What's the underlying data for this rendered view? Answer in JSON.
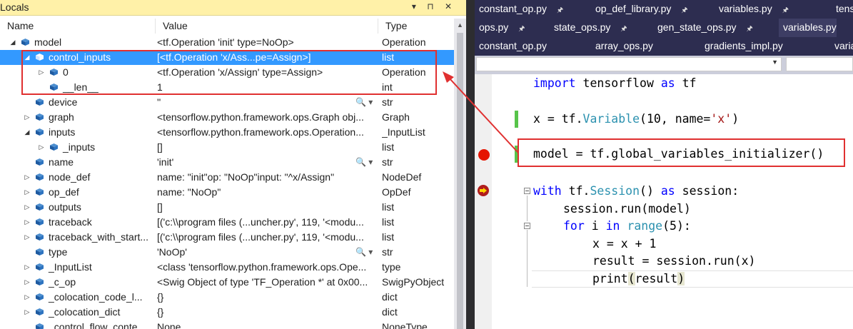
{
  "locals": {
    "title": "Locals",
    "controls": "▾ ⊓ ✕",
    "columns": {
      "name": "Name",
      "value": "Value",
      "type": "Type"
    },
    "rows": [
      {
        "name": "model",
        "value": "<tf.Operation 'init' type=NoOp>",
        "type": "Operation",
        "level": 0,
        "exp": "open"
      },
      {
        "name": "control_inputs",
        "value": "[<tf.Operation 'x/Ass...pe=Assign>]",
        "type": "list",
        "level": 1,
        "exp": "open",
        "selected": true
      },
      {
        "name": "0",
        "value": "<tf.Operation 'x/Assign' type=Assign>",
        "type": "Operation",
        "level": 2,
        "exp": "closed"
      },
      {
        "name": "__len__",
        "value": "1",
        "type": "int",
        "level": 2,
        "exp": "none"
      },
      {
        "name": "device",
        "value": "''",
        "type": "str",
        "level": 1,
        "exp": "none",
        "tools": true
      },
      {
        "name": "graph",
        "value": "<tensorflow.python.framework.ops.Graph obj...",
        "type": "Graph",
        "level": 1,
        "exp": "closed"
      },
      {
        "name": "inputs",
        "value": "<tensorflow.python.framework.ops.Operation...",
        "type": "_InputList",
        "level": 1,
        "exp": "open"
      },
      {
        "name": "_inputs",
        "value": "[]",
        "type": "list",
        "level": 2,
        "exp": "closed"
      },
      {
        "name": "name",
        "value": "'init'",
        "type": "str",
        "level": 1,
        "exp": "none",
        "tools": true
      },
      {
        "name": "node_def",
        "value": "name: \"init\"op: \"NoOp\"input: \"^x/Assign\"",
        "type": "NodeDef",
        "level": 1,
        "exp": "closed"
      },
      {
        "name": "op_def",
        "value": "name: \"NoOp\"",
        "type": "OpDef",
        "level": 1,
        "exp": "closed"
      },
      {
        "name": "outputs",
        "value": "[]",
        "type": "list",
        "level": 1,
        "exp": "closed"
      },
      {
        "name": "traceback",
        "value": "[('c:\\\\program files (...uncher.py', 119, '<modu...",
        "type": "list",
        "level": 1,
        "exp": "closed"
      },
      {
        "name": "traceback_with_start...",
        "value": "[('c:\\\\program files (...uncher.py', 119, '<modu...",
        "type": "list",
        "level": 1,
        "exp": "closed"
      },
      {
        "name": "type",
        "value": "'NoOp'",
        "type": "str",
        "level": 1,
        "exp": "none",
        "tools": true
      },
      {
        "name": "_InputList",
        "value": "<class 'tensorflow.python.framework.ops.Ope...",
        "type": "type",
        "level": 1,
        "exp": "closed"
      },
      {
        "name": "_c_op",
        "value": "<Swig Object of type 'TF_Operation *' at 0x00...",
        "type": "SwigPyObject",
        "level": 1,
        "exp": "closed"
      },
      {
        "name": "_colocation_code_l...",
        "value": "{}",
        "type": "dict",
        "level": 1,
        "exp": "closed"
      },
      {
        "name": "_colocation_dict",
        "value": "{}",
        "type": "dict",
        "level": 1,
        "exp": "closed"
      },
      {
        "name": "_control_flow_conte...",
        "value": "None",
        "type": "NoneType",
        "level": 1,
        "exp": "none"
      }
    ]
  },
  "editor": {
    "tabs_row1": [
      "constant_op.py",
      "op_def_library.py",
      "variables.py",
      "tensor..."
    ],
    "tabs_row2": [
      "ops.py",
      "state_ops.py",
      "gen_state_ops.py",
      "variables.py"
    ],
    "tabs_row3": [
      "constant_op.py",
      "array_ops.py",
      "gradients_impl.py",
      "variab..."
    ],
    "active_tab": "variables.py",
    "pin_glyph": "🖈",
    "code": {
      "l1": [
        "import",
        " tensorflow ",
        "as",
        " tf"
      ],
      "l2": [
        "x = tf.",
        "Variable",
        "(10, name=",
        "'x'",
        ")"
      ],
      "l3": [
        "model = tf.global_variables_initializer()"
      ],
      "l4": [
        "with",
        " tf.",
        "Session",
        "() ",
        "as",
        " session:"
      ],
      "l5": [
        "session.run(model)"
      ],
      "l6": [
        "for",
        " i ",
        "in",
        " ",
        "range",
        "(5):"
      ],
      "l7": [
        "x = x + 1"
      ],
      "l8": [
        "result = session.run(x)"
      ],
      "l9": [
        "print",
        "(",
        "result",
        ")"
      ]
    }
  }
}
